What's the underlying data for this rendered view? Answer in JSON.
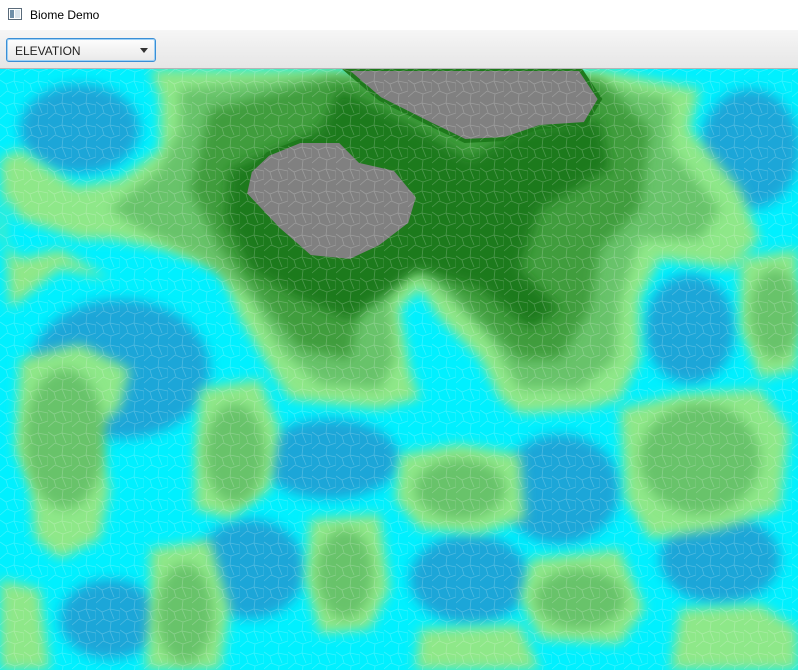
{
  "window": {
    "title": "Biome Demo",
    "icon": "window-app-icon"
  },
  "toolbar": {
    "mode_select": {
      "value": "ELEVATION",
      "icon": "chevron-down-icon"
    }
  },
  "map": {
    "colors": {
      "deep_water": "#1aa6d8",
      "water": "#16c7ea",
      "shallow_water": "#00f0ff",
      "beach": "#8ee889",
      "lowland": "#67c36a",
      "hill": "#3f9d3c",
      "forest": "#1e7a1c",
      "mountain": "#808080"
    }
  }
}
